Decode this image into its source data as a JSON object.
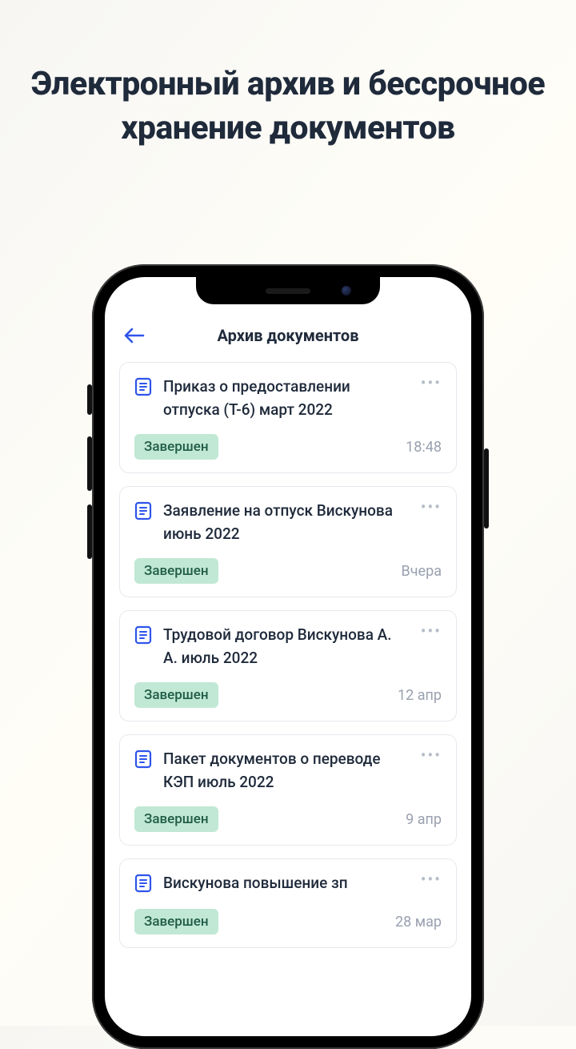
{
  "headline": "Электронный архив и бессрочное хранение документов",
  "header": {
    "title": "Архив документов"
  },
  "documents": [
    {
      "title": "Приказ о предоставлении отпуска (Т-6) март 2022",
      "status": "Завершен",
      "time": "18:48"
    },
    {
      "title": "Заявление на отпуск Вискунова июнь 2022",
      "status": "Завершен",
      "time": "Вчера"
    },
    {
      "title": "Трудовой договор Вискунова А. А. июль 2022",
      "status": "Завершен",
      "time": "12 апр"
    },
    {
      "title": "Пакет документов о переводе КЭП июль 2022",
      "status": "Завершен",
      "time": "9 апр"
    },
    {
      "title": "Вискунова повышение зп",
      "status": "Завершен",
      "time": "28 мар"
    }
  ]
}
